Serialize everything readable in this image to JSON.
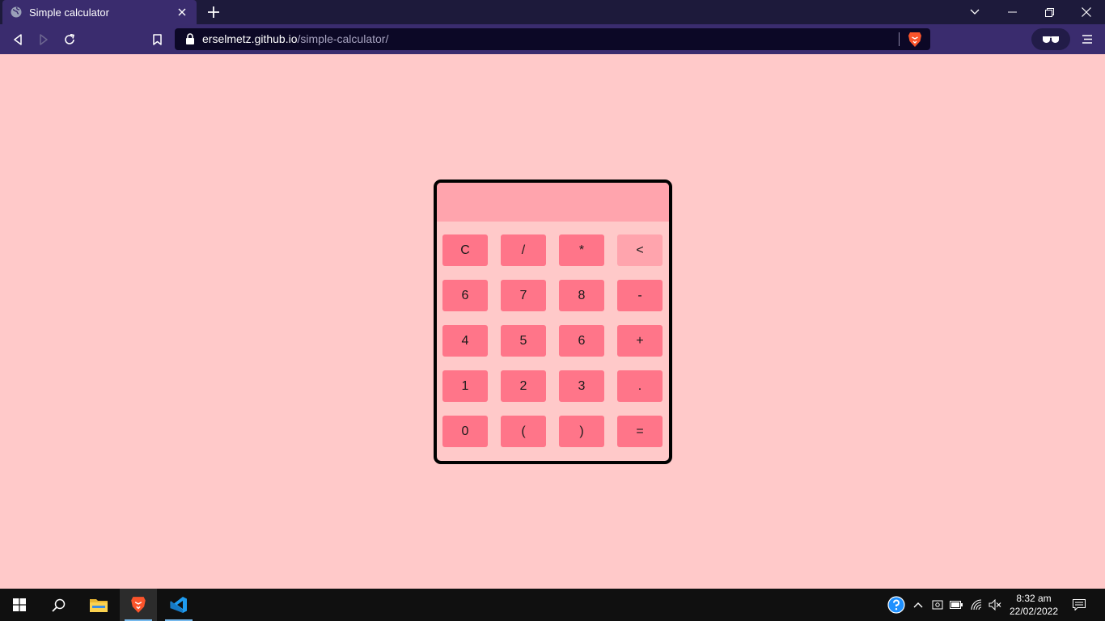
{
  "browser": {
    "tab_title": "Simple calculator",
    "url_host": "erselmetz.github.io",
    "url_path": "/simple-calculator/"
  },
  "calculator": {
    "display_value": "",
    "keys": [
      "C",
      "/",
      "*",
      "<",
      "6",
      "7",
      "8",
      "-",
      "4",
      "5",
      "6",
      "+",
      "1",
      "2",
      "3",
      ".",
      "0",
      "(",
      ")",
      "="
    ]
  },
  "taskbar": {
    "time": "8:32 am",
    "date": "22/02/2022"
  },
  "colors": {
    "page_background": "#ffc9c9",
    "display_background": "#ffa4ad",
    "key_background": "#ff7589",
    "backspace_key_background": "#ffa4ad",
    "browser_toolbar": "#3a2c6e",
    "taskbar": "#101010"
  },
  "icons": {
    "tab": "globe-icon",
    "browser_menu": "hamburger-icon",
    "extension": "glasses-icon",
    "start": "windows-logo-icon",
    "search": "search-icon"
  }
}
